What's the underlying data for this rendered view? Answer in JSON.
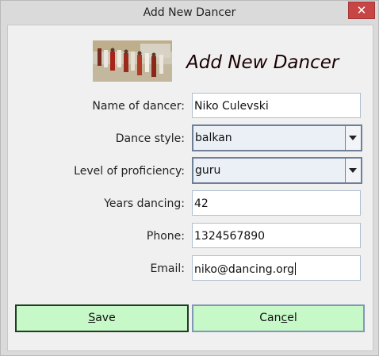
{
  "window": {
    "title": "Add New Dancer",
    "close_glyph": "✕"
  },
  "header": {
    "title": "Add New Dancer",
    "image_icon": "folk-dancers-photo"
  },
  "form": {
    "name_label": "Name of dancer:",
    "name_value": "Niko Culevski",
    "style_label": "Dance style:",
    "style_value": "balkan",
    "level_label": "Level of proficiency:",
    "level_value": "guru",
    "years_label": "Years dancing:",
    "years_value": "42",
    "phone_label": "Phone:",
    "phone_value": "1324567890",
    "email_label": "Email:",
    "email_value": "niko@dancing.org"
  },
  "buttons": {
    "save_prefix": "",
    "save_mnemonic": "S",
    "save_suffix": "ave",
    "cancel_prefix": "Can",
    "cancel_mnemonic": "c",
    "cancel_suffix": "el"
  },
  "colors": {
    "button_bg": "#c6f8c8",
    "close_bg": "#c74545",
    "heading": "#1a0000"
  }
}
